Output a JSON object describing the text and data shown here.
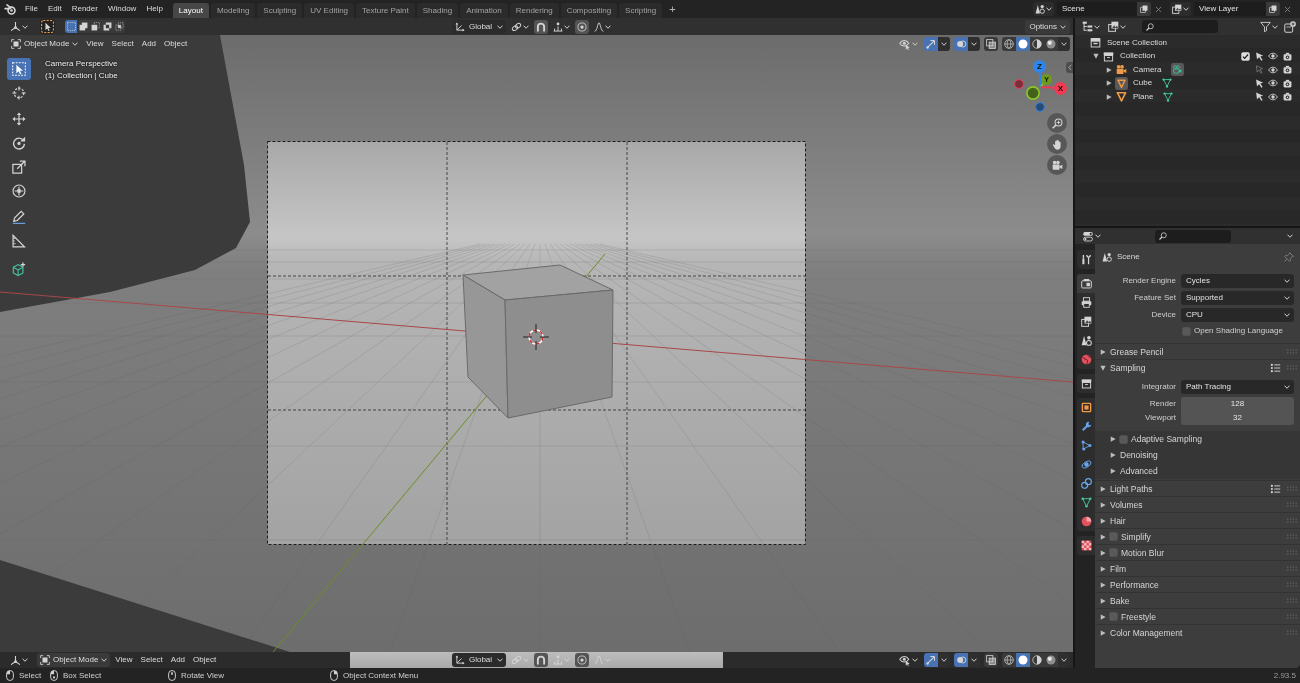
{
  "top_bar": {
    "menus": [
      "File",
      "Edit",
      "Render",
      "Window",
      "Help"
    ],
    "workspaces": [
      {
        "label": "Layout",
        "selected": true
      },
      {
        "label": "Modeling",
        "selected": false
      },
      {
        "label": "Sculpting",
        "selected": false
      },
      {
        "label": "UV Editing",
        "selected": false
      },
      {
        "label": "Texture Paint",
        "selected": false
      },
      {
        "label": "Shading",
        "selected": false
      },
      {
        "label": "Animation",
        "selected": false
      },
      {
        "label": "Rendering",
        "selected": false
      },
      {
        "label": "Compositing",
        "selected": false
      },
      {
        "label": "Scripting",
        "selected": false
      }
    ],
    "add_workspace": "+",
    "scene": "Scene",
    "view_layer": "View Layer"
  },
  "tool_settings": {
    "select_modes": [
      {
        "kind": "new",
        "selected": true
      },
      {
        "kind": "extend",
        "selected": false
      },
      {
        "kind": "subtract",
        "selected": false
      },
      {
        "kind": "difference",
        "selected": false
      },
      {
        "kind": "intersect",
        "selected": false
      }
    ],
    "orientation": "Global",
    "options": "Options"
  },
  "viewport_header": {
    "mode": "Object Mode",
    "menus": [
      "View",
      "Select",
      "Add",
      "Object"
    ],
    "gizmos_on": true,
    "overlays_on": true,
    "xray_on": false,
    "shading": [
      {
        "kind": "wireframe",
        "selected": false
      },
      {
        "kind": "solid",
        "selected": true
      },
      {
        "kind": "material",
        "selected": false
      },
      {
        "kind": "rendered",
        "selected": false
      }
    ]
  },
  "toolbar": {
    "groups": [
      {
        "tools": [
          {
            "kind": "select-box",
            "selected": true
          },
          {
            "kind": "cursor",
            "selected": false
          }
        ]
      },
      {
        "tools": [
          {
            "kind": "move",
            "selected": false
          },
          {
            "kind": "rotate",
            "selected": false
          },
          {
            "kind": "scale",
            "selected": false
          },
          {
            "kind": "transform",
            "selected": false
          }
        ]
      },
      {
        "tools": [
          {
            "kind": "annotate",
            "selected": false
          },
          {
            "kind": "measure",
            "selected": false
          }
        ]
      },
      {
        "tools": [
          {
            "kind": "add-cube",
            "selected": false
          }
        ]
      }
    ]
  },
  "viewport": {
    "view_name": "Camera Perspective",
    "context": "(1) Collection | Cube",
    "gizmo_axes": [
      "Z",
      "Y",
      "X"
    ]
  },
  "outliner": {
    "tree": [
      {
        "label": "Scene Collection",
        "kind": "scene-collection",
        "children": [
          {
            "label": "Collection",
            "kind": "collection",
            "expanded": true,
            "checked": true,
            "selectable": true,
            "children": [
              {
                "label": "Camera",
                "kind": "camera",
                "expanded": false,
                "active": false,
                "selectable": false
              },
              {
                "label": "Cube",
                "kind": "mesh",
                "expanded": false,
                "active": true,
                "selectable": true
              },
              {
                "label": "Plane",
                "kind": "mesh",
                "expanded": false,
                "active": false,
                "selectable": true
              }
            ]
          }
        ]
      }
    ]
  },
  "properties": {
    "tab_groups": [
      {
        "tabs": [
          {
            "kind": "tool",
            "selected": false
          }
        ]
      },
      {
        "tabs": [
          {
            "kind": "render",
            "selected": true
          },
          {
            "kind": "output",
            "selected": false
          },
          {
            "kind": "view-layer",
            "selected": false
          },
          {
            "kind": "scene",
            "selected": false
          },
          {
            "kind": "world",
            "selected": false
          }
        ]
      },
      {
        "tabs": [
          {
            "kind": "collection",
            "selected": false
          }
        ]
      },
      {
        "tabs": [
          {
            "kind": "object",
            "selected": false
          },
          {
            "kind": "modifiers",
            "selected": false
          },
          {
            "kind": "particles",
            "selected": false
          },
          {
            "kind": "physics",
            "selected": false
          },
          {
            "kind": "constraints",
            "selected": false
          },
          {
            "kind": "data",
            "selected": false
          },
          {
            "kind": "material",
            "selected": false
          }
        ]
      },
      {
        "tabs": [
          {
            "kind": "texture",
            "selected": false
          }
        ]
      }
    ],
    "context": "Scene",
    "settings": [
      {
        "kind": "dropdown",
        "label": "Render Engine",
        "value": "Cycles"
      },
      {
        "kind": "dropdown",
        "label": "Feature Set",
        "value": "Supported"
      },
      {
        "kind": "dropdown",
        "label": "Device",
        "value": "CPU"
      },
      {
        "kind": "checkbox",
        "label": "Open Shading Language",
        "checked": false
      }
    ],
    "panels": [
      {
        "title": "Grease Pencil",
        "kind": "plain",
        "expanded": false
      },
      {
        "title": "Sampling",
        "kind": "plain",
        "expanded": true,
        "presets": true,
        "settings": [
          {
            "kind": "dropdown",
            "label": "Integrator",
            "value": "Path Tracing"
          },
          {
            "kind": "number",
            "label": "Render",
            "value": "128"
          },
          {
            "kind": "number",
            "label": "Viewport",
            "value": "32"
          }
        ],
        "subpanels": [
          {
            "title": "Adaptive Sampling",
            "kind": "toggle",
            "checked": false,
            "expanded": false
          },
          {
            "title": "Denoising",
            "kind": "plain",
            "expanded": false
          },
          {
            "title": "Advanced",
            "kind": "plain",
            "expanded": false
          }
        ]
      },
      {
        "title": "Light Paths",
        "kind": "plain",
        "expanded": false,
        "presets": true
      },
      {
        "title": "Volumes",
        "kind": "plain",
        "expanded": false
      },
      {
        "title": "Hair",
        "kind": "plain",
        "expanded": false
      },
      {
        "title": "Simplify",
        "kind": "toggle",
        "checked": false,
        "expanded": false
      },
      {
        "title": "Motion Blur",
        "kind": "toggle",
        "checked": false,
        "expanded": false
      },
      {
        "title": "Film",
        "kind": "plain",
        "expanded": false
      },
      {
        "title": "Performance",
        "kind": "plain",
        "expanded": false
      },
      {
        "title": "Bake",
        "kind": "plain",
        "expanded": false
      },
      {
        "title": "Freestyle",
        "kind": "toggle",
        "checked": false,
        "expanded": false
      },
      {
        "title": "Color Management",
        "kind": "plain",
        "expanded": false
      }
    ]
  },
  "bottom_header": {
    "mode": "Object Mode",
    "menus": [
      "View",
      "Select",
      "Add",
      "Object"
    ],
    "orientation": "Global",
    "gizmos_on": true,
    "overlays_on": true,
    "xray_on": false,
    "shading": [
      {
        "kind": "wireframe",
        "selected": false
      },
      {
        "kind": "solid",
        "selected": true
      },
      {
        "kind": "material",
        "selected": false
      },
      {
        "kind": "rendered",
        "selected": false
      }
    ]
  },
  "status_bar": {
    "hints": [
      {
        "kind": "left-click",
        "label": "Select"
      },
      {
        "kind": "left-drag",
        "label": "Box Select"
      },
      {
        "kind": "middle-drag",
        "label": "Rotate View"
      },
      {
        "kind": "right-click",
        "label": "Object Context Menu"
      }
    ],
    "version": "2.93.5"
  }
}
